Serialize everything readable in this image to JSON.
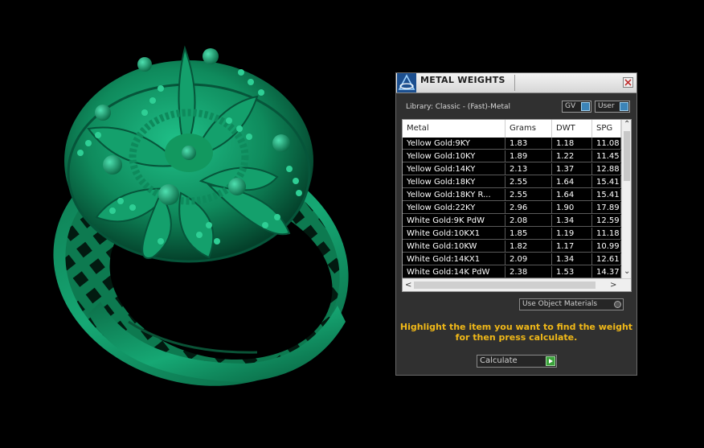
{
  "panel": {
    "title": "METAL WEIGHTS",
    "library_label": "Library: Classic - (Fast)-Metal",
    "gv_label": "GV",
    "user_label": "User",
    "use_object_label": "Use Object Materials",
    "hint_line1": "Highlight the item you want to find the weight",
    "hint_line2": "for then press calculate.",
    "calculate_label": "Calculate",
    "accent_color": "#f0b818"
  },
  "table": {
    "headers": [
      "Metal",
      "Grams",
      "DWT",
      "SPG"
    ],
    "rows": [
      [
        "Yellow Gold:9KY",
        "1.83",
        "1.18",
        "11.08"
      ],
      [
        "Yellow Gold:10KY",
        "1.89",
        "1.22",
        "11.45"
      ],
      [
        "Yellow Gold:14KY",
        "2.13",
        "1.37",
        "12.88"
      ],
      [
        "Yellow Gold:18KY",
        "2.55",
        "1.64",
        "15.41"
      ],
      [
        "Yellow Gold:18KY R...",
        "2.55",
        "1.64",
        "15.41"
      ],
      [
        "Yellow Gold:22KY",
        "2.96",
        "1.90",
        "17.89"
      ],
      [
        "White Gold:9K PdW",
        "2.08",
        "1.34",
        "12.59"
      ],
      [
        "White Gold:10KX1",
        "1.85",
        "1.19",
        "11.18"
      ],
      [
        "White Gold:10KW",
        "1.82",
        "1.17",
        "10.99"
      ],
      [
        "White Gold:14KX1",
        "2.09",
        "1.34",
        "12.61"
      ],
      [
        "White Gold:14K PdW",
        "2.38",
        "1.53",
        "14.37"
      ]
    ]
  }
}
